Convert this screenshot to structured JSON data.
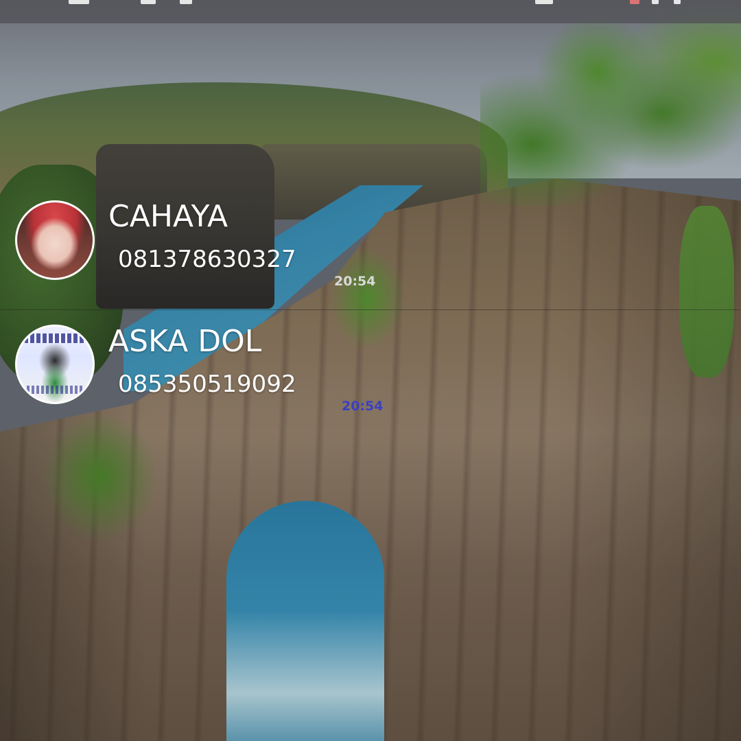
{
  "contacts": [
    {
      "name": "CAHAYA",
      "number": "081378630327",
      "time": "20:54",
      "avatar_icon": "profile-photo",
      "time_color": "#d9d9d9"
    },
    {
      "name": "ASKA DOL",
      "number": "085350519092",
      "time": "20:54",
      "avatar_icon": "profile-photo",
      "time_color": "#3b3fc4"
    }
  ],
  "colors": {
    "text": "#ffffff",
    "status_bar": "#505055"
  }
}
